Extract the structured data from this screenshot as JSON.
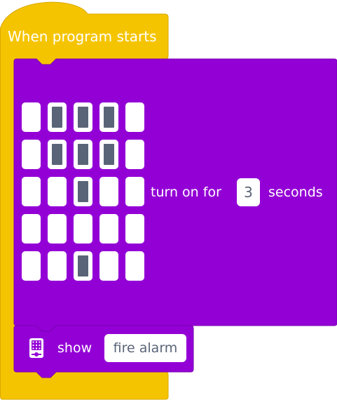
{
  "hat_block": {
    "label": "When program starts",
    "color": "#f5c400"
  },
  "matrix_block": {
    "color": "#9300d6",
    "action_label": "turn on for",
    "duration_value": "3",
    "unit_label": "seconds",
    "grid": [
      [
        0,
        1,
        1,
        1,
        0
      ],
      [
        0,
        1,
        1,
        1,
        0
      ],
      [
        0,
        0,
        1,
        0,
        0
      ],
      [
        0,
        0,
        0,
        0,
        0
      ],
      [
        0,
        0,
        1,
        0,
        0
      ]
    ],
    "pixel_on_color": "#5a6478",
    "pixel_off_color": "#ffffff"
  },
  "show_block": {
    "icon": "hub-display-icon",
    "label": "show",
    "value": "fire alarm"
  }
}
